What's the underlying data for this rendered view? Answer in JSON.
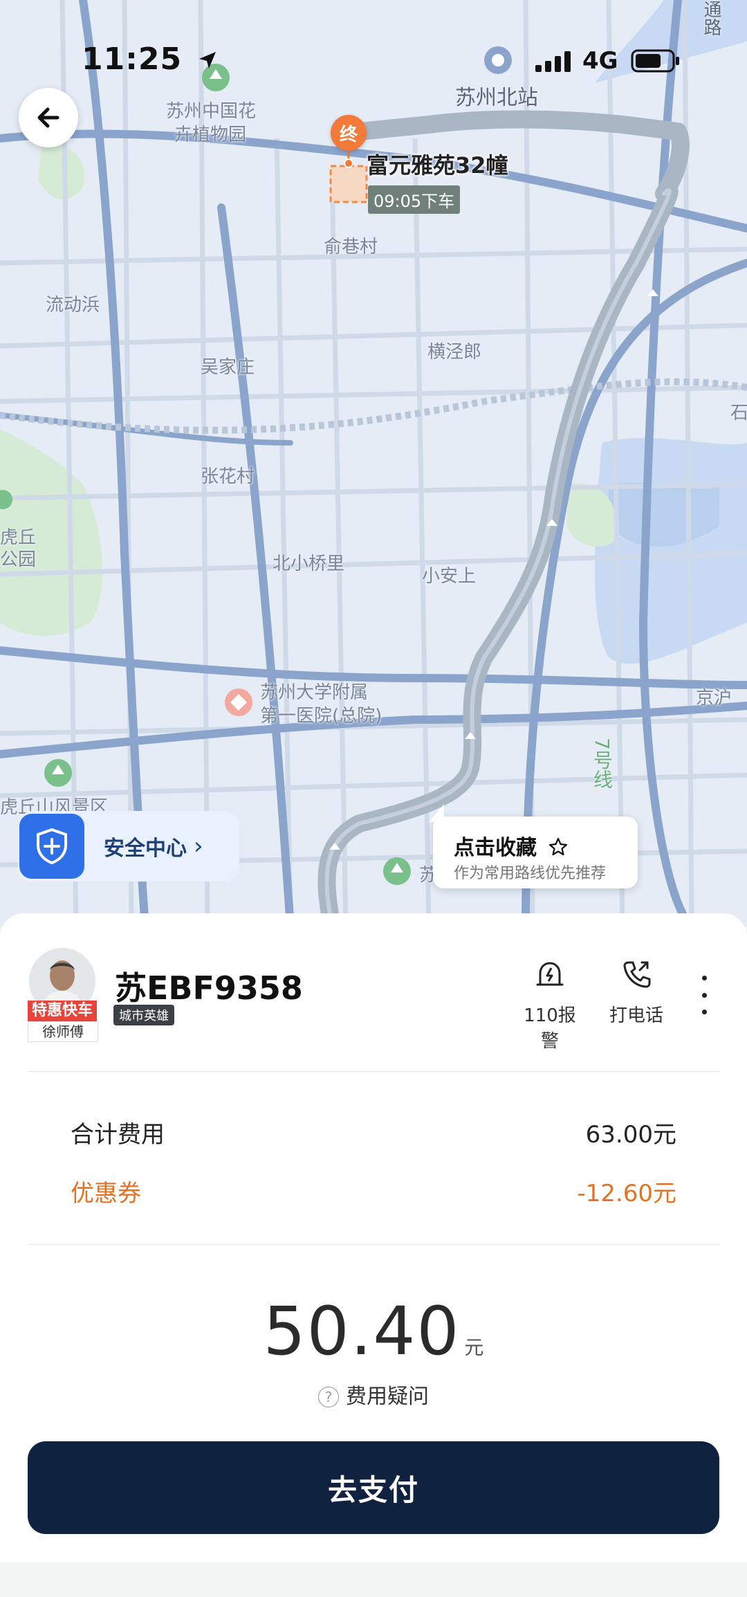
{
  "status_bar": {
    "time": "11:25",
    "network": "4G"
  },
  "map": {
    "labels": {
      "botanical_garden_1": "苏州中国花",
      "botanical_garden_2": "卉植物园",
      "north_station": "苏州北站",
      "road_top_right": "通路",
      "yuxiang": "俞巷村",
      "liudong": "流动浜",
      "wujiazhuang": "吴家庄",
      "hengjinglang": "横泾郎",
      "zhanghuacun": "张花村",
      "huqiu_1": "虎丘",
      "huqiu_2": "公园",
      "beixiaoqiao": "北小桥里",
      "xiaoanshang": "小安上",
      "hospital_1": "苏州大学附属",
      "hospital_2": "第一医院(总院)",
      "jinghu": "京沪",
      "line7": "7号线",
      "huqiushan": "虎丘山风景区",
      "su": "苏",
      "shi": "石"
    },
    "destination": {
      "pin_label": "终",
      "name": "富元雅苑32幢",
      "dropoff_time": "09:05下车"
    }
  },
  "safety_center": {
    "label": "安全中心"
  },
  "favorite_tip": {
    "title": "点击收藏",
    "subtitle": "作为常用路线优先推荐"
  },
  "driver": {
    "service_type": "特惠快车",
    "name": "徐师傅",
    "plate": "苏EBF9358",
    "tag": "城市英雄"
  },
  "actions": {
    "police": "110报警",
    "call": "打电话"
  },
  "fees": {
    "total_label": "合计费用",
    "total_value": "63.00元",
    "coupon_label": "优惠券",
    "coupon_value": "-12.60元"
  },
  "payment": {
    "amount": "50.40",
    "unit": "元",
    "question_label": "费用疑问",
    "pay_button": "去支付"
  },
  "colors": {
    "accent_dark": "#0f2340",
    "coupon_orange": "#e37322",
    "safety_blue": "#2f6fe8",
    "route_gray": "#a9b6c4",
    "destination_orange": "#f27a3a"
  }
}
